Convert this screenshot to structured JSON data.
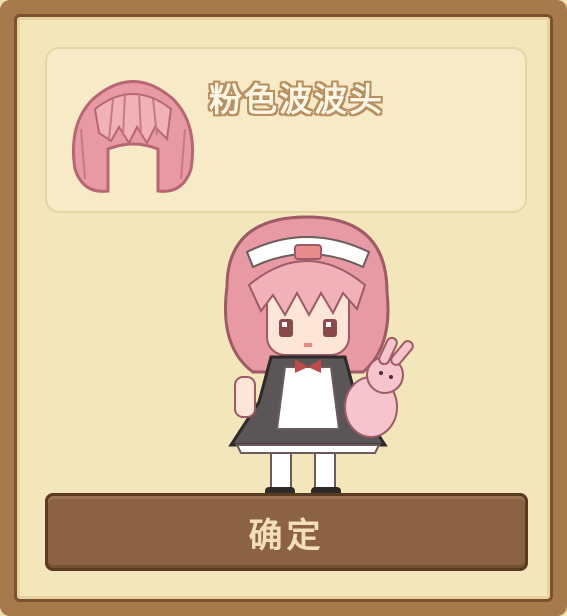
{
  "dialog": {
    "item_name": "粉色波波头",
    "item_icon": "pink-bob-wig-icon",
    "preview_character": "maid-girl-pink-bob-with-bunny-plush",
    "confirm_label": "确定"
  },
  "colors": {
    "frame": "#a77a4b",
    "panel": "#f4e6bb",
    "hair_pink": "#e79aa3",
    "button": "#8b6344",
    "button_text": "#f3dfb8"
  }
}
